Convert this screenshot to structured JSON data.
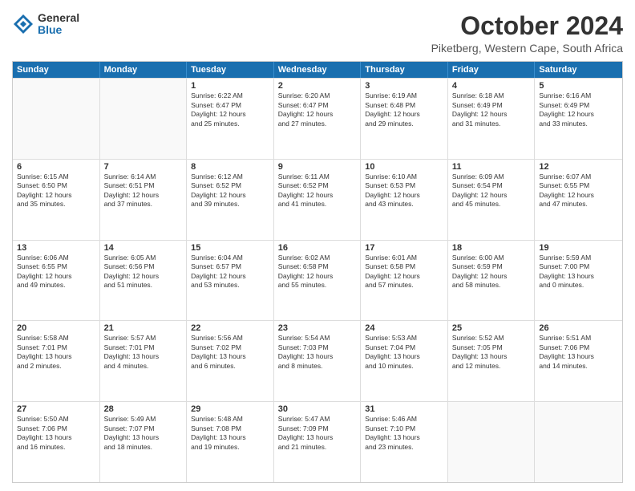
{
  "logo": {
    "general": "General",
    "blue": "Blue"
  },
  "title": "October 2024",
  "location": "Piketberg, Western Cape, South Africa",
  "days": [
    "Sunday",
    "Monday",
    "Tuesday",
    "Wednesday",
    "Thursday",
    "Friday",
    "Saturday"
  ],
  "weeks": [
    [
      {
        "day": "",
        "info": ""
      },
      {
        "day": "",
        "info": ""
      },
      {
        "day": "1",
        "info": "Sunrise: 6:22 AM\nSunset: 6:47 PM\nDaylight: 12 hours\nand 25 minutes."
      },
      {
        "day": "2",
        "info": "Sunrise: 6:20 AM\nSunset: 6:47 PM\nDaylight: 12 hours\nand 27 minutes."
      },
      {
        "day": "3",
        "info": "Sunrise: 6:19 AM\nSunset: 6:48 PM\nDaylight: 12 hours\nand 29 minutes."
      },
      {
        "day": "4",
        "info": "Sunrise: 6:18 AM\nSunset: 6:49 PM\nDaylight: 12 hours\nand 31 minutes."
      },
      {
        "day": "5",
        "info": "Sunrise: 6:16 AM\nSunset: 6:49 PM\nDaylight: 12 hours\nand 33 minutes."
      }
    ],
    [
      {
        "day": "6",
        "info": "Sunrise: 6:15 AM\nSunset: 6:50 PM\nDaylight: 12 hours\nand 35 minutes."
      },
      {
        "day": "7",
        "info": "Sunrise: 6:14 AM\nSunset: 6:51 PM\nDaylight: 12 hours\nand 37 minutes."
      },
      {
        "day": "8",
        "info": "Sunrise: 6:12 AM\nSunset: 6:52 PM\nDaylight: 12 hours\nand 39 minutes."
      },
      {
        "day": "9",
        "info": "Sunrise: 6:11 AM\nSunset: 6:52 PM\nDaylight: 12 hours\nand 41 minutes."
      },
      {
        "day": "10",
        "info": "Sunrise: 6:10 AM\nSunset: 6:53 PM\nDaylight: 12 hours\nand 43 minutes."
      },
      {
        "day": "11",
        "info": "Sunrise: 6:09 AM\nSunset: 6:54 PM\nDaylight: 12 hours\nand 45 minutes."
      },
      {
        "day": "12",
        "info": "Sunrise: 6:07 AM\nSunset: 6:55 PM\nDaylight: 12 hours\nand 47 minutes."
      }
    ],
    [
      {
        "day": "13",
        "info": "Sunrise: 6:06 AM\nSunset: 6:55 PM\nDaylight: 12 hours\nand 49 minutes."
      },
      {
        "day": "14",
        "info": "Sunrise: 6:05 AM\nSunset: 6:56 PM\nDaylight: 12 hours\nand 51 minutes."
      },
      {
        "day": "15",
        "info": "Sunrise: 6:04 AM\nSunset: 6:57 PM\nDaylight: 12 hours\nand 53 minutes."
      },
      {
        "day": "16",
        "info": "Sunrise: 6:02 AM\nSunset: 6:58 PM\nDaylight: 12 hours\nand 55 minutes."
      },
      {
        "day": "17",
        "info": "Sunrise: 6:01 AM\nSunset: 6:58 PM\nDaylight: 12 hours\nand 57 minutes."
      },
      {
        "day": "18",
        "info": "Sunrise: 6:00 AM\nSunset: 6:59 PM\nDaylight: 12 hours\nand 58 minutes."
      },
      {
        "day": "19",
        "info": "Sunrise: 5:59 AM\nSunset: 7:00 PM\nDaylight: 13 hours\nand 0 minutes."
      }
    ],
    [
      {
        "day": "20",
        "info": "Sunrise: 5:58 AM\nSunset: 7:01 PM\nDaylight: 13 hours\nand 2 minutes."
      },
      {
        "day": "21",
        "info": "Sunrise: 5:57 AM\nSunset: 7:01 PM\nDaylight: 13 hours\nand 4 minutes."
      },
      {
        "day": "22",
        "info": "Sunrise: 5:56 AM\nSunset: 7:02 PM\nDaylight: 13 hours\nand 6 minutes."
      },
      {
        "day": "23",
        "info": "Sunrise: 5:54 AM\nSunset: 7:03 PM\nDaylight: 13 hours\nand 8 minutes."
      },
      {
        "day": "24",
        "info": "Sunrise: 5:53 AM\nSunset: 7:04 PM\nDaylight: 13 hours\nand 10 minutes."
      },
      {
        "day": "25",
        "info": "Sunrise: 5:52 AM\nSunset: 7:05 PM\nDaylight: 13 hours\nand 12 minutes."
      },
      {
        "day": "26",
        "info": "Sunrise: 5:51 AM\nSunset: 7:06 PM\nDaylight: 13 hours\nand 14 minutes."
      }
    ],
    [
      {
        "day": "27",
        "info": "Sunrise: 5:50 AM\nSunset: 7:06 PM\nDaylight: 13 hours\nand 16 minutes."
      },
      {
        "day": "28",
        "info": "Sunrise: 5:49 AM\nSunset: 7:07 PM\nDaylight: 13 hours\nand 18 minutes."
      },
      {
        "day": "29",
        "info": "Sunrise: 5:48 AM\nSunset: 7:08 PM\nDaylight: 13 hours\nand 19 minutes."
      },
      {
        "day": "30",
        "info": "Sunrise: 5:47 AM\nSunset: 7:09 PM\nDaylight: 13 hours\nand 21 minutes."
      },
      {
        "day": "31",
        "info": "Sunrise: 5:46 AM\nSunset: 7:10 PM\nDaylight: 13 hours\nand 23 minutes."
      },
      {
        "day": "",
        "info": ""
      },
      {
        "day": "",
        "info": ""
      }
    ]
  ]
}
